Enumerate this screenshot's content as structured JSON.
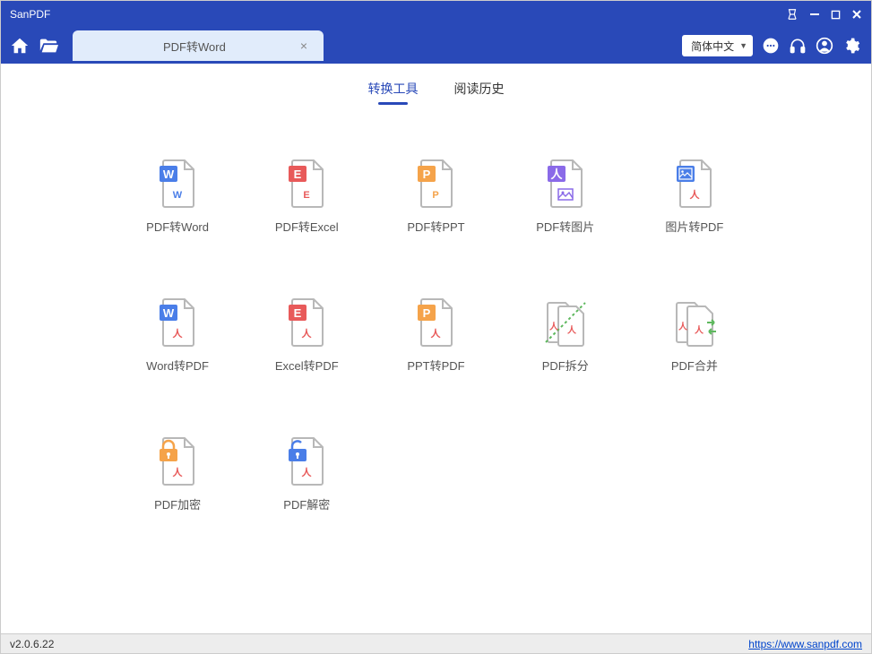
{
  "titlebar": {
    "appName": "SanPDF"
  },
  "toolbar": {
    "tab": {
      "label": "PDF转Word"
    },
    "language": "简体中文"
  },
  "contentTabs": {
    "convert": "转换工具",
    "history": "阅读历史"
  },
  "tools": {
    "pdf2word": "PDF转Word",
    "pdf2excel": "PDF转Excel",
    "pdf2ppt": "PDF转PPT",
    "pdf2img": "PDF转图片",
    "img2pdf": "图片转PDF",
    "word2pdf": "Word转PDF",
    "excel2pdf": "Excel转PDF",
    "ppt2pdf": "PPT转PDF",
    "pdfsplit": "PDF拆分",
    "pdfmerge": "PDF合并",
    "pdfencrypt": "PDF加密",
    "pdfdecrypt": "PDF解密"
  },
  "statusbar": {
    "version": "v2.0.6.22",
    "url": "https://www.sanpdf.com"
  }
}
